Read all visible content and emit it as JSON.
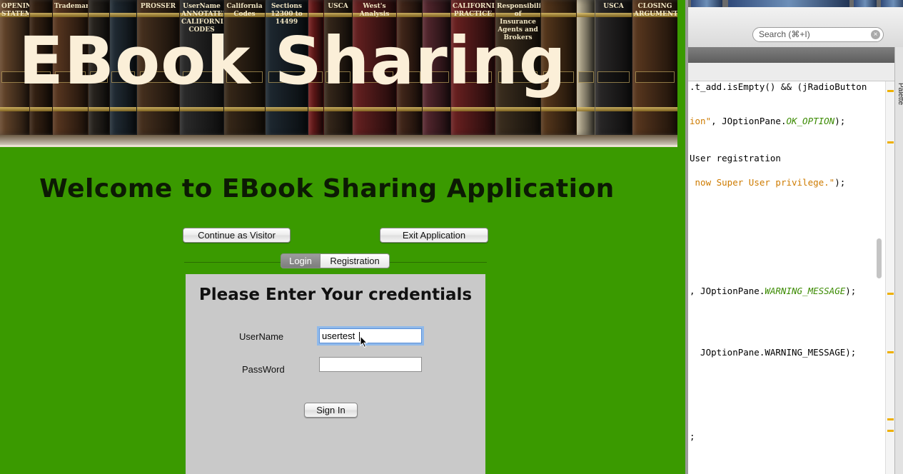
{
  "banner": {
    "title": "EBook Sharing",
    "spines": [
      {
        "text": "OPENING STATEMENTS",
        "color": "#6b4a2e"
      },
      {
        "text": "",
        "color": "#3c2616"
      },
      {
        "text": "Trademarks",
        "color": "#5e3a22"
      },
      {
        "text": "",
        "color": "#2f2a24"
      },
      {
        "text": "",
        "color": "#24303a"
      },
      {
        "text": "PROSSER",
        "color": "#4a3320"
      },
      {
        "text": "UserName ANNOTATED CALIFORNIA CODES",
        "color": "#2d2d2d"
      },
      {
        "text": "California Codes",
        "color": "#3a2a1a"
      },
      {
        "text": "Sections 12300 to 14499",
        "color": "#1f2a33"
      },
      {
        "text": "",
        "color": "#7a1f1f"
      },
      {
        "text": "USCA",
        "color": "#3b2b1d"
      },
      {
        "text": "West's Analysis",
        "color": "#6a2222"
      },
      {
        "text": "",
        "color": "#4a2b1d"
      },
      {
        "text": "",
        "color": "#5b2a32"
      },
      {
        "text": "CALIFORNIA PRACTICE",
        "color": "#6e2222"
      },
      {
        "text": "Responsibilities of Insurance Agents and Brokers",
        "color": "#3e3020"
      },
      {
        "text": "",
        "color": "#5c3b1e"
      },
      {
        "text": "",
        "color": "#c9bea0"
      },
      {
        "text": "USCA",
        "color": "#2c2a2a"
      },
      {
        "text": "CLOSING ARGUMENT",
        "color": "#5d3a20"
      }
    ]
  },
  "welcome": "Welcome to EBook Sharing Application",
  "buttons": {
    "visitor": "Continue as Visitor",
    "exit": "Exit Application",
    "signin": "Sign In"
  },
  "tabs": {
    "login": "Login",
    "registration": "Registration"
  },
  "login_panel": {
    "title": "Please Enter Your credentials",
    "username_label": "UserName",
    "username_value": "usertest",
    "password_label": "PassWord",
    "password_value": ""
  },
  "ide": {
    "search_placeholder": "Search (⌘+I)",
    "palette_label": "Palette",
    "code_lines": [
      {
        "pre": ".t_add.isEmpty() && (jRadioButton",
        "str": "",
        "mid": "",
        "it": "",
        "post": "",
        "cls": "cm"
      },
      {
        "pre": "",
        "str": "ion\"",
        "mid": ", JOptionPane.",
        "it": "OK_OPTION",
        "post": ");",
        "cls": ""
      },
      {
        "pre": "User registration",
        "str": "",
        "mid": "",
        "it": "",
        "post": "",
        "cls": "cm"
      },
      {
        "pre": " ",
        "str": "now Super User privilege.\"",
        "mid": ");",
        "it": "",
        "post": "",
        "cls": ""
      },
      {
        "pre": ", JOptionPane.",
        "str": "",
        "mid": "",
        "it": "WARNING_MESSAGE",
        "post": ");",
        "cls": ""
      },
      {
        "pre": "  JOptionPane.WARNING_MESSAGE);",
        "str": "",
        "mid": "",
        "it": "",
        "post": "",
        "cls": "cm"
      },
      {
        "pre": ";",
        "str": "",
        "mid": "",
        "it": "",
        "post": "",
        "cls": "cm"
      }
    ]
  }
}
